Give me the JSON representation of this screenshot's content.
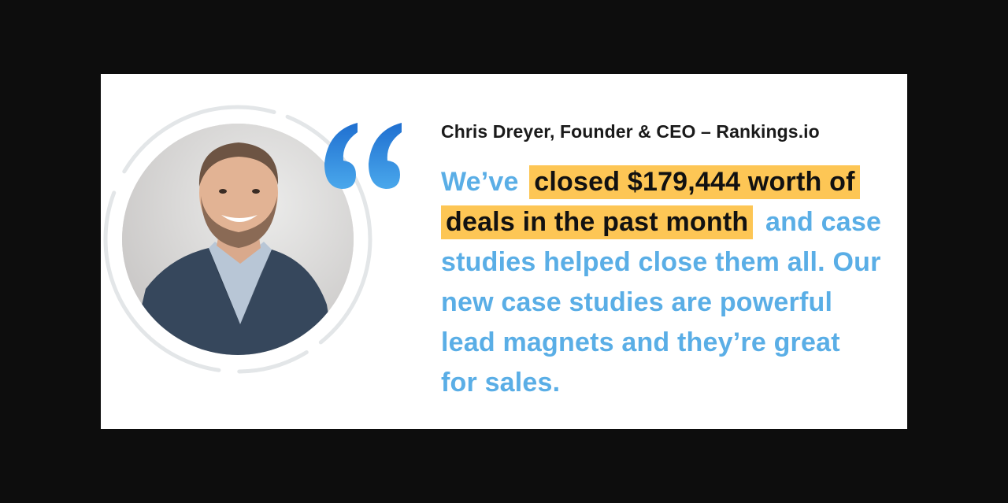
{
  "testimonial": {
    "attribution": "Chris Dreyer, Founder & CEO – Rankings.io",
    "quote_lines": [
      {
        "before": "We’ve ",
        "highlight": "closed $179,444 worth of",
        "after": ""
      },
      {
        "before": "",
        "highlight": "deals in the past month",
        "after": " and case"
      },
      {
        "before": "studies helped close them all. Our",
        "highlight": "",
        "after": ""
      },
      {
        "before": "new case studies are powerful",
        "highlight": "",
        "after": ""
      },
      {
        "before": "lead magnets and they’re great",
        "highlight": "",
        "after": ""
      },
      {
        "before": "for sales.",
        "highlight": "",
        "after": ""
      }
    ],
    "photo_icon": "person-portrait",
    "quote_icon": "quotation-mark-icon"
  },
  "colors": {
    "background": "#0d0d0d",
    "card": "#ffffff",
    "quote_text": "#5aaee6",
    "highlight": "#fdc655",
    "quote_mark_top": "#1f6fd0",
    "quote_mark_bottom": "#4aa8ec",
    "ring": "#e3e6e8"
  }
}
